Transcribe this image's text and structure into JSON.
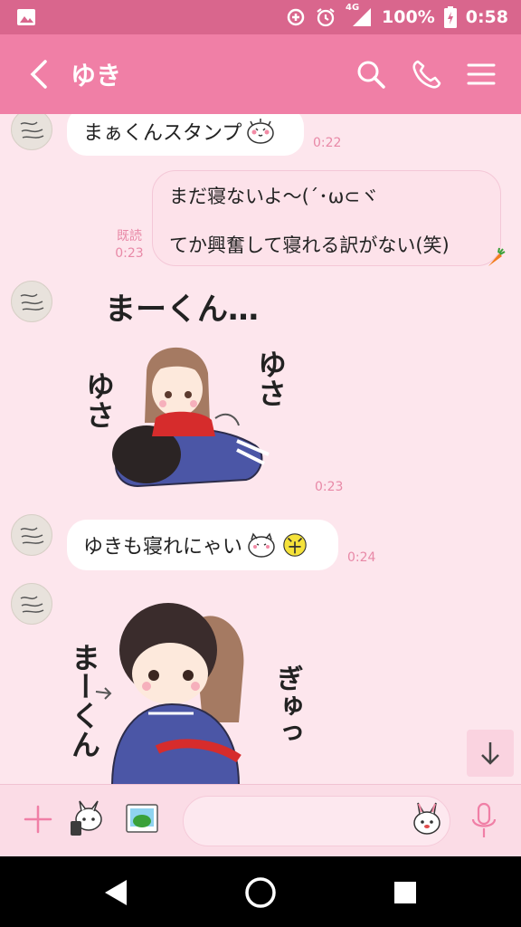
{
  "status_bar": {
    "network": "4G",
    "battery": "100%",
    "time": "0:58",
    "icons": [
      "image-icon",
      "data-saver-icon",
      "alarm-icon",
      "signal-icon",
      "battery-icon"
    ]
  },
  "header": {
    "title": "ゆき",
    "icons": [
      "back-icon",
      "search-icon",
      "phone-icon",
      "menu-icon"
    ]
  },
  "messages": [
    {
      "type": "text_in",
      "text": "まぁくんスタンプ",
      "time": "0:22"
    },
    {
      "type": "text_out",
      "lines": [
        "まだ寝ないよ〜(´･ω⊂ヾ",
        "てか興奮して寝れる訳がない(笑)"
      ],
      "read": "既読",
      "time": "0:23"
    },
    {
      "type": "sticker_in",
      "caption": "まーくん…",
      "side_left": "ゆさ",
      "side_right": "ゆさ",
      "time": "0:23"
    },
    {
      "type": "text_in",
      "text": "ゆきも寝れにゃい",
      "time": "0:24"
    },
    {
      "type": "sticker_in",
      "left_text": "まーくん",
      "right_text": "ぎゅっ"
    }
  ],
  "input": {
    "placeholder": ""
  },
  "colors": {
    "header": "#f07fa6",
    "status": "#d9668d",
    "chat_bg": "#fde6ed",
    "time": "#e889a7"
  }
}
